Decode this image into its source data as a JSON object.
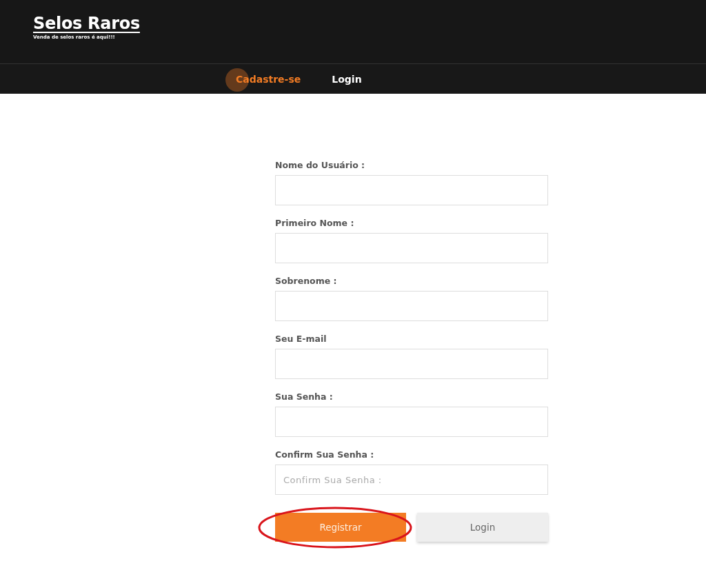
{
  "header": {
    "title": "Selos Raros",
    "tagline": "Venda de selos raros é aqui!!!"
  },
  "nav": [
    {
      "label": "Cadastre-se",
      "selected": true
    },
    {
      "label": "Login",
      "selected": false
    }
  ],
  "form": {
    "fields": [
      {
        "label": "Nome do Usuário :"
      },
      {
        "label": "Primeiro Nome :"
      },
      {
        "label": "Sobrenome :"
      },
      {
        "label": "Seu E-mail"
      },
      {
        "label": "Sua Senha :"
      },
      {
        "label": "Confirm Sua Senha :",
        "placeholder": "Confirm Sua Senha :"
      }
    ],
    "buttons": [
      {
        "label": "Registrar",
        "kind": "primary",
        "highlighted": true
      },
      {
        "label": "Login",
        "kind": "secondary",
        "highlighted": false
      }
    ]
  }
}
